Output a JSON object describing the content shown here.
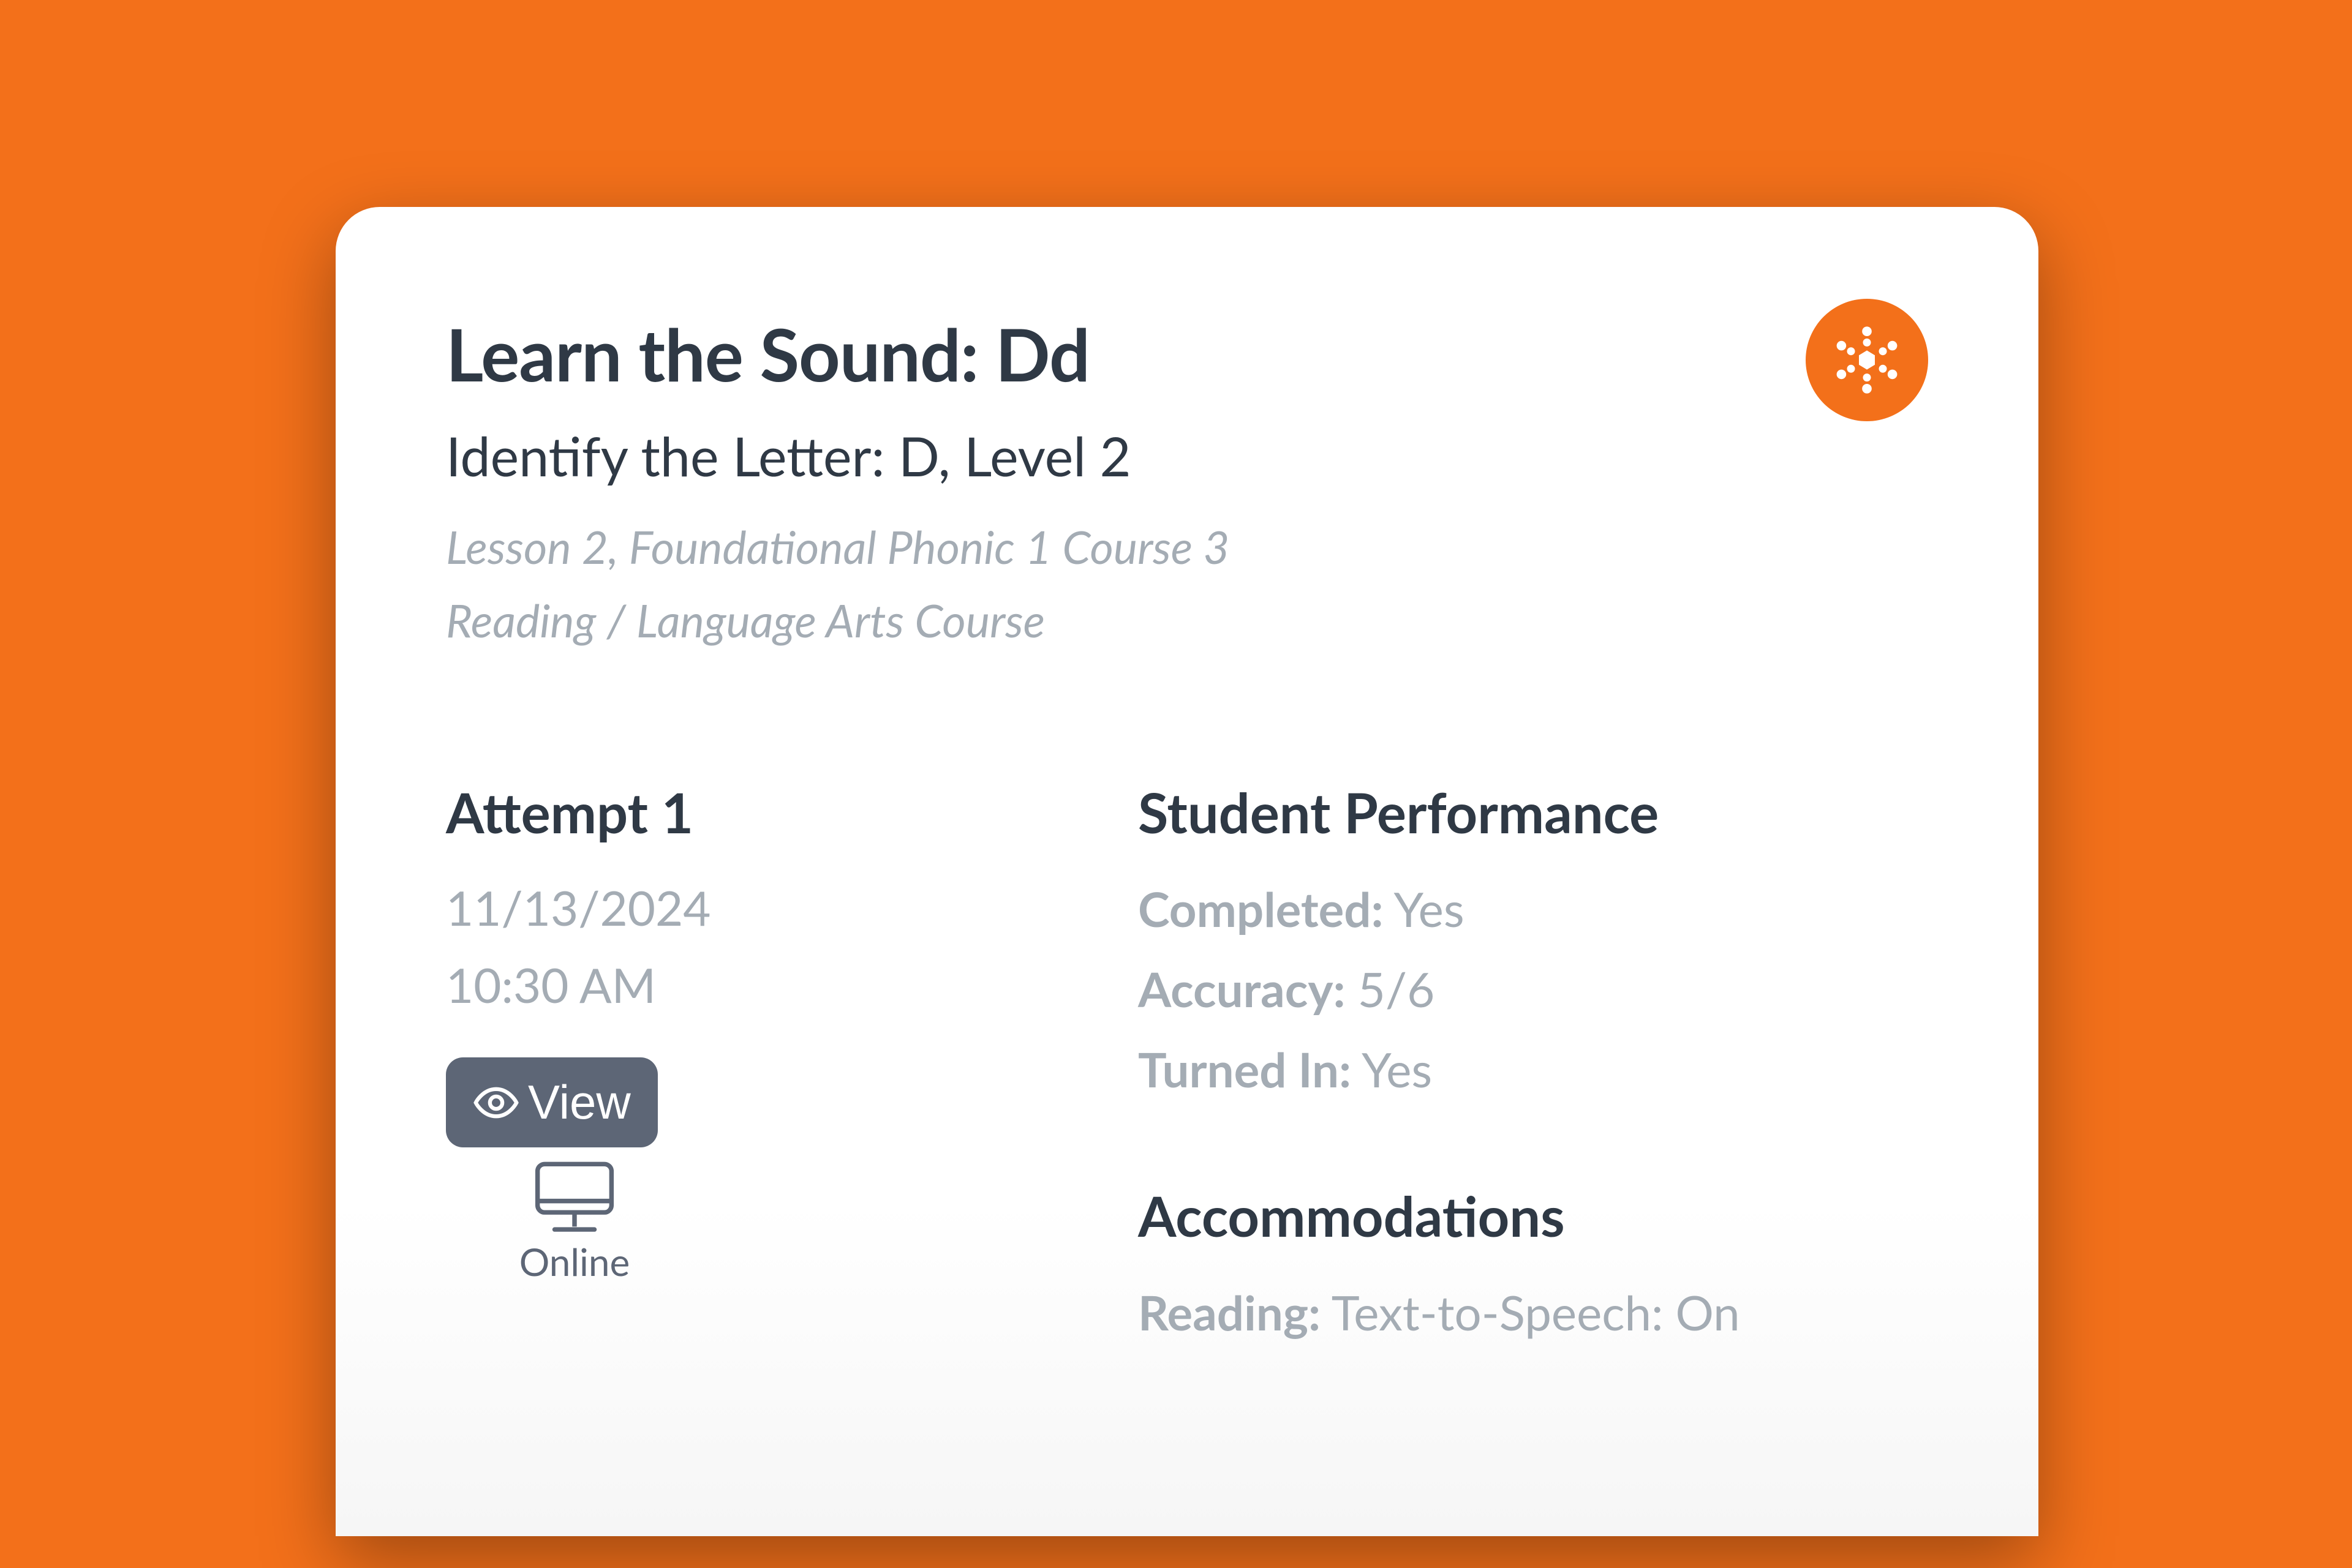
{
  "header": {
    "title": "Learn the Sound: Dd",
    "subtitle": "Identify the Letter: D, Level 2",
    "meta_line1": "Lesson 2, Foundational Phonic 1 Course 3",
    "meta_line2": "Reading / Language Arts Course"
  },
  "attempt": {
    "heading": "Attempt 1",
    "date": "11/13/2024",
    "time": "10:30 AM",
    "view_label": "View",
    "mode_label": "Online"
  },
  "performance": {
    "heading": "Student Performance",
    "completed_label": "Completed:",
    "completed_value": "Yes",
    "accuracy_label": "Accuracy:",
    "accuracy_value": "5/6",
    "turned_in_label": "Turned In:",
    "turned_in_value": "Yes"
  },
  "accommodations": {
    "heading": "Accommodations",
    "reading_label": "Reading:",
    "reading_value": "Text-to-Speech: On"
  }
}
